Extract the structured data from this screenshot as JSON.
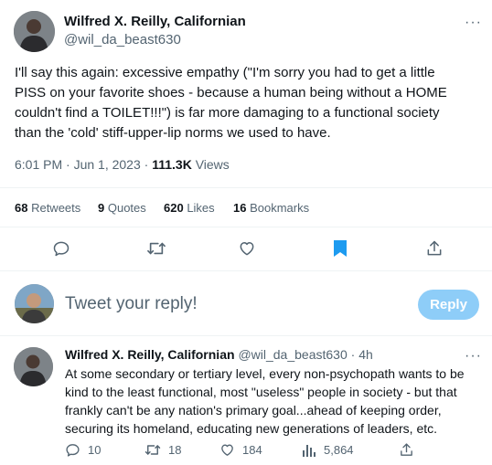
{
  "tweet": {
    "author_name": "Wilfred X. Reilly, Californian",
    "author_handle": "@wil_da_beast630",
    "more_label": "···",
    "text_lines": [
      "I'll say this again: excessive empathy (\"I'm sorry you had to get a little",
      "PISS on your favorite shoes - because a human being without a HOME",
      "couldn't find a TOILET!!!\") is far more damaging to a functional society",
      "than the 'cold' stiff-upper-lip norms we used to have."
    ],
    "time": "6:01 PM · Jun 1, 2023 · ",
    "views_count": "111.3K",
    "views_label": " Views",
    "stats": [
      {
        "count": "68",
        "label": " Retweets"
      },
      {
        "count": "9",
        "label": " Quotes"
      },
      {
        "count": "620",
        "label": " Likes"
      },
      {
        "count": "16",
        "label": " Bookmarks"
      }
    ]
  },
  "compose": {
    "placeholder": "Tweet your reply!",
    "button_label": "Reply"
  },
  "reply": {
    "author_name": "Wilfred X. Reilly, Californian",
    "author_handle": "@wil_da_beast630",
    "time_sep": " · ",
    "time": "4h",
    "more_label": "···",
    "text_lines": [
      "At some secondary or tertiary level, every non-psychopath wants to be",
      "kind to the least functional, most \"useless\" people in society - but that",
      "frankly can't be any nation's primary goal...ahead of keeping order,",
      "securing its homeland, educating new generations of leaders, etc."
    ],
    "replies_count": "10",
    "retweets_count": "18",
    "likes_count": "184",
    "views_count": "5,864"
  },
  "colors": {
    "accent": "#1d9bf0",
    "muted": "#536471",
    "reply_button": "#8ecdf8"
  }
}
